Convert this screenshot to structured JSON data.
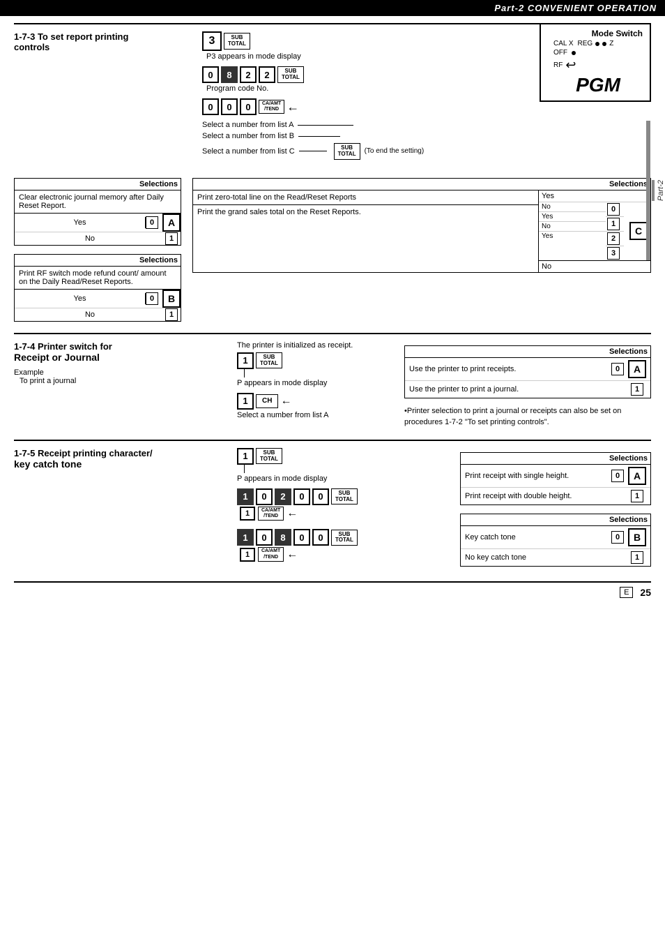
{
  "header": {
    "title": "Part-2 CONVENIENT OPERATION"
  },
  "mode_switch": {
    "title": "Mode Switch",
    "cal_x": "CAL X",
    "reg": "REG",
    "z": "Z",
    "off": "OFF",
    "rf": "RF",
    "pgm": "PGM"
  },
  "section_173": {
    "title": "1-7-3  To set report printing controls",
    "steps": [
      {
        "key": "3",
        "label": "SUB\nTOTAL",
        "note": "P3 appears in mode display"
      },
      {
        "keys": [
          "0",
          "8",
          "2",
          "2"
        ],
        "label": "SUB\nTOTAL",
        "note": "Program code No."
      },
      {
        "keys": [
          "0",
          "0",
          "0"
        ],
        "label": "CA/AMT\n/TEND",
        "note": ""
      }
    ],
    "select_labels": [
      "Select a number from list A",
      "Select a number from list B",
      "Select a number from list C"
    ],
    "sub_total_note": "(To end the setting)",
    "table_a": {
      "header": "Selections",
      "desc": "Clear electronic journal memory after Daily Reset Report.",
      "rows": [
        {
          "label": "Yes",
          "value": "0"
        },
        {
          "label": "No",
          "value": "1"
        }
      ],
      "badge": "A"
    },
    "table_b": {
      "header": "Selections",
      "desc": "Print RF switch mode  refund count/ amount on the Daily Read/Reset Reports.",
      "rows": [
        {
          "label": "Yes",
          "value": "0"
        },
        {
          "label": "No",
          "value": "1"
        }
      ],
      "badge": "B"
    },
    "table_c_left": {
      "header": "Selections",
      "desc": "Print zero-total line on the Read/Reset Reports",
      "desc2": "Print the grand sales total on the Reset Reports.",
      "rows_yes1": "Yes",
      "rows_no1": "No",
      "rows_yes2": "Yes",
      "rows_no2": "No",
      "rows_yes3": "Yes",
      "values": [
        "0",
        "1",
        "2",
        "3"
      ],
      "labels": [
        "No",
        "Yes",
        "No",
        "Yes"
      ],
      "badge": "C"
    }
  },
  "section_174": {
    "title": "1-7-4  Printer switch for",
    "title2": "Receipt or Journal",
    "note": "The printer is initialized as receipt.",
    "step1_key": "1",
    "step1_label": "SUB\nTOTAL",
    "step1_note": "P appears in  mode display",
    "step2_key": "1",
    "step2_label": "CH",
    "step2_note": "Select a number from list A",
    "example": "Example",
    "example_detail": "To print a journal",
    "table": {
      "header": "Selections",
      "rows": [
        {
          "label": "Use the printer to print receipts.",
          "value": "0"
        },
        {
          "label": "Use the printer to print a journal.",
          "value": "1"
        }
      ],
      "badge": "A"
    },
    "bullet_note": "•Printer selection to print a journal or receipts can also be set on procedures 1-7-2 \"To set printing controls\"."
  },
  "section_175": {
    "title": "1-7-5  Receipt printing character/",
    "title2": "key catch tone",
    "step1_key": "1",
    "step1_label": "SUB\nTOTAL",
    "step1_note": "P appears in mode display",
    "seq_a_keys": [
      "1",
      "0",
      "2",
      "0",
      "0"
    ],
    "seq_a_label": "SUB\nTOTAL",
    "seq_a_arrow_key": "CA/AMT\n/TEND",
    "seq_b_keys": [
      "1",
      "0",
      "8",
      "0",
      "0"
    ],
    "seq_b_label": "SUB\nTOTAL",
    "seq_b_arrow_key": "CA/AMT\n/TEND",
    "table_a": {
      "header": "Selections",
      "rows": [
        {
          "label": "Print receipt with single height.",
          "value": "0"
        },
        {
          "label": "Print receipt with double height.",
          "value": "1"
        }
      ],
      "badge": "A"
    },
    "table_b": {
      "header": "Selections",
      "rows": [
        {
          "label": "Key catch tone",
          "value": "0"
        },
        {
          "label": "No key catch tone",
          "value": "1"
        }
      ],
      "badge": "B"
    }
  },
  "page_number": "25",
  "page_letter": "E",
  "part2_label": "Part-2"
}
